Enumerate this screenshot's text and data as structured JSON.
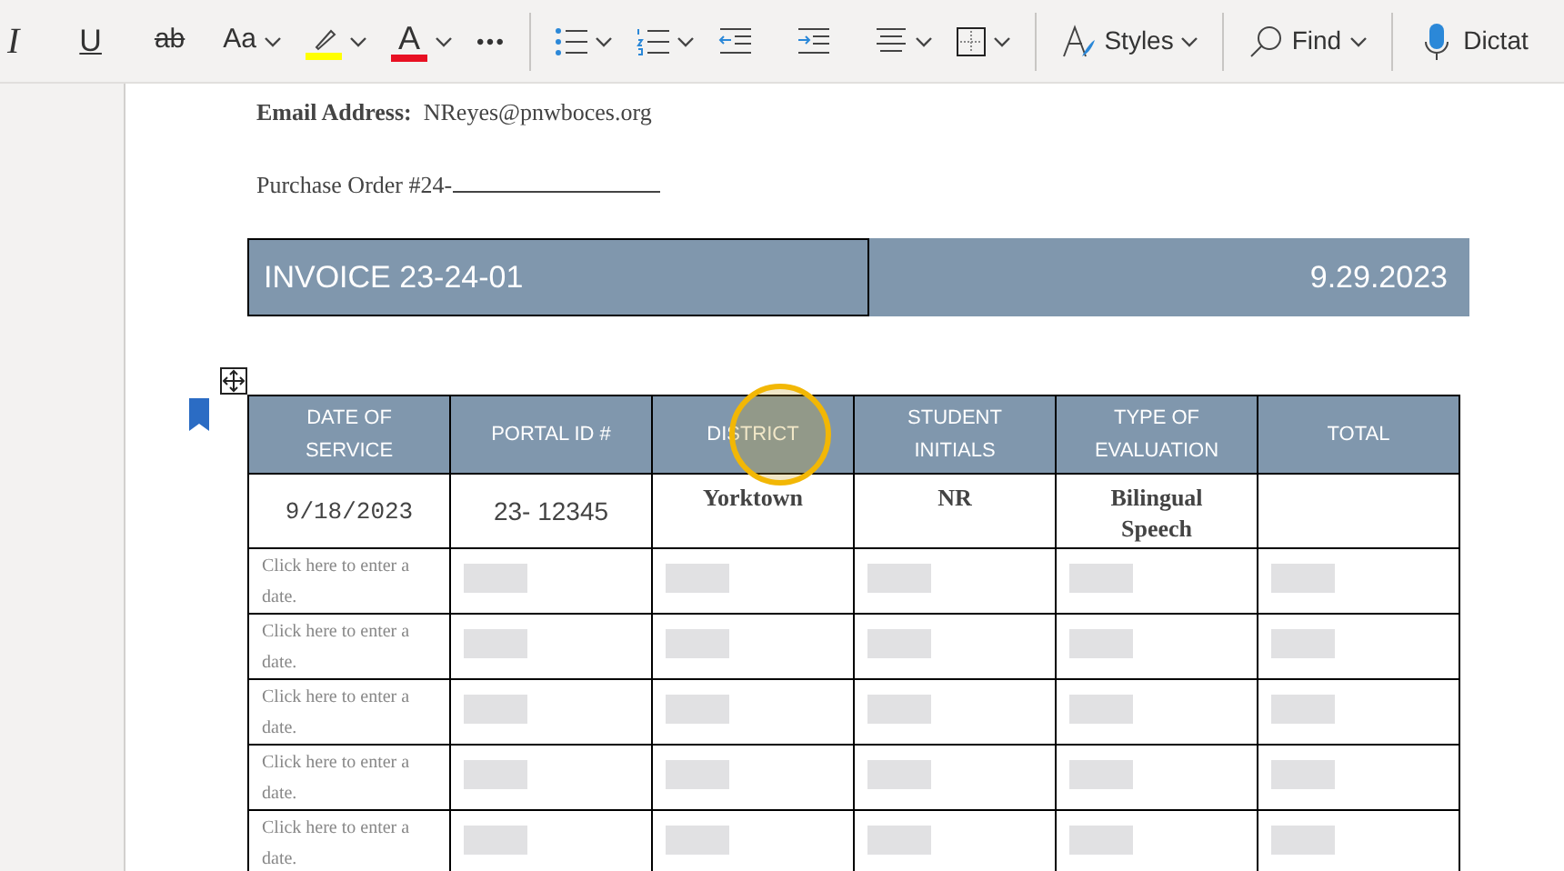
{
  "toolbar": {
    "items": [
      {
        "kind": "italic",
        "label": "I"
      },
      {
        "kind": "underline",
        "label": "U"
      },
      {
        "kind": "strike",
        "label": "ab"
      },
      {
        "kind": "case",
        "label": "Aa"
      },
      {
        "kind": "highlight",
        "color": "#ffff00"
      },
      {
        "kind": "fontcolor",
        "label": "A",
        "color": "#e81123"
      },
      {
        "kind": "more",
        "label": "•••"
      },
      {
        "kind": "divider"
      },
      {
        "kind": "bullets"
      },
      {
        "kind": "numbering"
      },
      {
        "kind": "outdent"
      },
      {
        "kind": "indent"
      },
      {
        "kind": "align"
      },
      {
        "kind": "borders"
      },
      {
        "kind": "divider"
      },
      {
        "kind": "styles",
        "label": "Styles"
      },
      {
        "kind": "divider"
      },
      {
        "kind": "find",
        "label": "Find"
      },
      {
        "kind": "divider"
      },
      {
        "kind": "dictate",
        "label": "Dictat"
      }
    ]
  },
  "document": {
    "email_label": "Email Address:",
    "email": "NReyes@pnwboces.org",
    "purchase_order": "Purchase Order #24-",
    "invoice_title": "INVOICE 23-24-01",
    "invoice_date": "9.29.2023",
    "table": {
      "columns": [
        "DATE OF SERVICE",
        "PORTAL ID #",
        "DISTRICT",
        "STUDENT INITIALS",
        "TYPE OF EVALUATION",
        "TOTAL"
      ],
      "rows": [
        {
          "kind": "filled",
          "cells": [
            "9/18/2023",
            "23- 12345",
            "Yorktown",
            "NR",
            "Bilingual Speech",
            ""
          ]
        },
        {
          "kind": "empty",
          "cells": [
            "Click here to enter a date."
          ]
        },
        {
          "kind": "empty",
          "cells": [
            "Click here to enter a date."
          ]
        },
        {
          "kind": "empty",
          "cells": [
            "Click here to enter a date."
          ]
        },
        {
          "kind": "empty",
          "cells": [
            "Click here to enter a date."
          ]
        },
        {
          "kind": "empty",
          "cells": [
            "Click here to enter a date."
          ]
        }
      ]
    }
  }
}
